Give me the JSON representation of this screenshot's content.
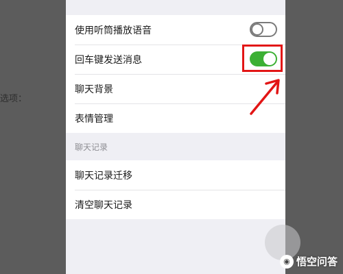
{
  "background": {
    "side_text": "选项："
  },
  "settings": {
    "rows_group1": [
      {
        "label": "使用听筒播放语音",
        "toggle": "off"
      },
      {
        "label": "回车键发送消息",
        "toggle": "on"
      },
      {
        "label": "聊天背景"
      },
      {
        "label": "表情管理"
      }
    ],
    "section_header": "聊天记录",
    "rows_group2": [
      {
        "label": "聊天记录迁移"
      },
      {
        "label": "清空聊天记录"
      }
    ]
  },
  "colors": {
    "toggle_on": "#3cb034",
    "highlight": "#e21515"
  },
  "watermark": {
    "text": "悟空问答",
    "logo_glyph": "◉"
  }
}
